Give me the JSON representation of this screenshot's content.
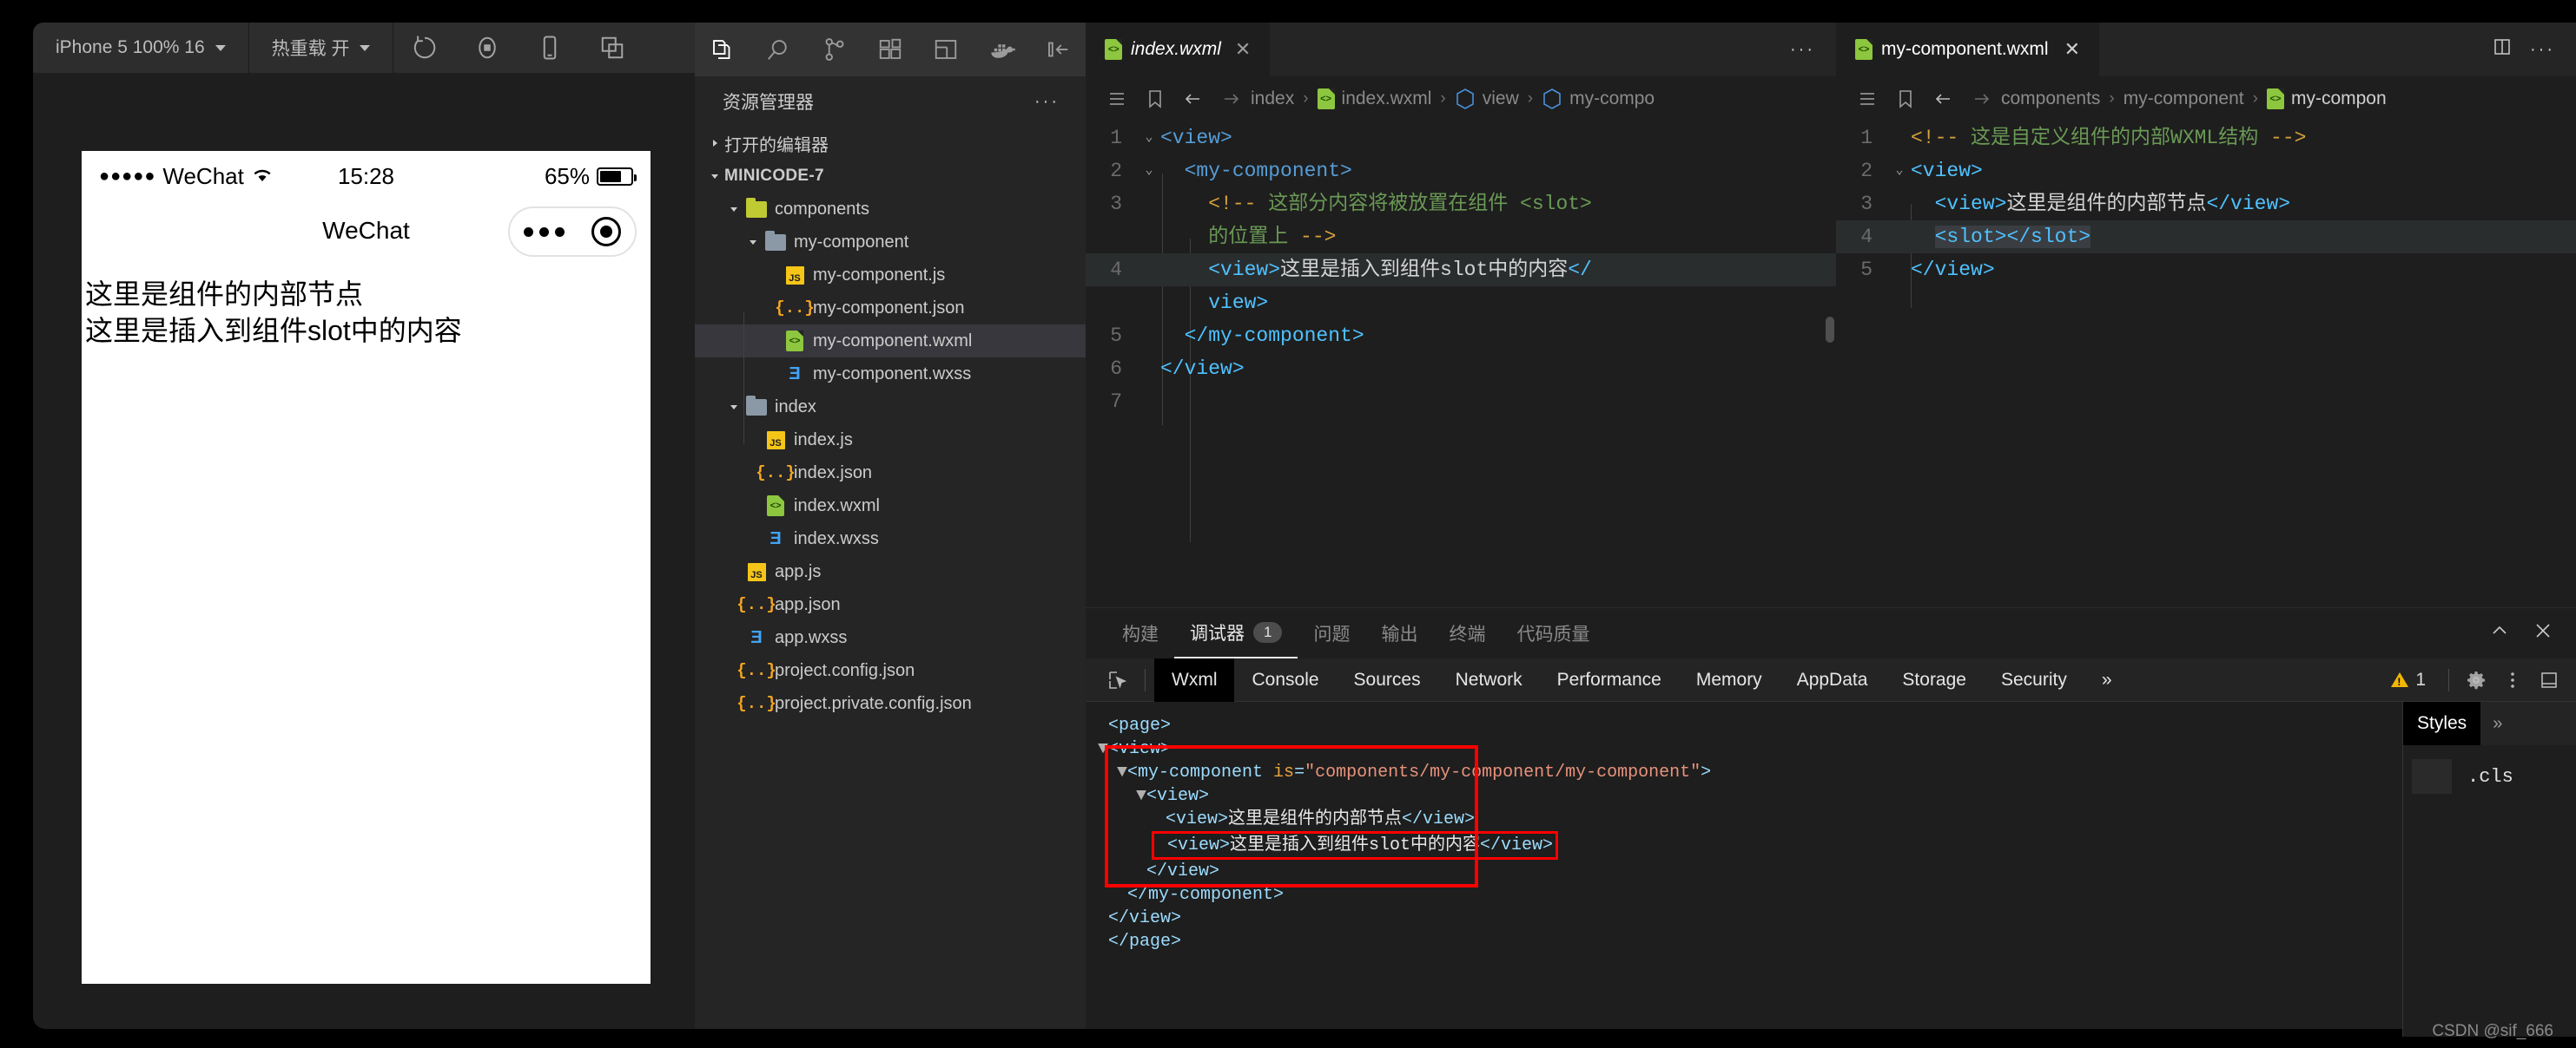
{
  "simulator": {
    "toolbar": {
      "device_label": "iPhone 5 100% 16",
      "hotreload_label": "热重载 开",
      "icons": [
        "refresh-icon",
        "record-icon",
        "phone-icon",
        "copy-icon"
      ]
    },
    "status_bar": {
      "signal_dots": "●●●●●",
      "carrier": "WeChat",
      "wifi": "wifi-icon",
      "time": "15:28",
      "battery_percent": "65%"
    },
    "nav_title": "WeChat",
    "page_lines": [
      "这里是组件的内部节点",
      "这里是插入到组件slot中的内容"
    ]
  },
  "activity_bar": {
    "icons": [
      "files-icon",
      "search-icon",
      "source-control-icon",
      "extensions-icon",
      "layout-icon",
      "docker-icon",
      "collapse-icon"
    ]
  },
  "explorer": {
    "title": "资源管理器",
    "more": "···",
    "open_editors_label": "打开的编辑器",
    "project_label": "MINICODE-7",
    "tree": [
      {
        "label": "components",
        "kind": "folder-components",
        "depth": 1,
        "expanded": true,
        "selected": false
      },
      {
        "label": "my-component",
        "kind": "folder",
        "depth": 2,
        "expanded": true,
        "selected": false
      },
      {
        "label": "my-component.js",
        "kind": "js",
        "depth": 3,
        "selected": false
      },
      {
        "label": "my-component.json",
        "kind": "json",
        "depth": 3,
        "selected": false
      },
      {
        "label": "my-component.wxml",
        "kind": "wxml",
        "depth": 3,
        "selected": true
      },
      {
        "label": "my-component.wxss",
        "kind": "wxss",
        "depth": 3,
        "selected": false
      },
      {
        "label": "index",
        "kind": "folder",
        "depth": 1,
        "expanded": true,
        "selected": false
      },
      {
        "label": "index.js",
        "kind": "js",
        "depth": 2,
        "selected": false
      },
      {
        "label": "index.json",
        "kind": "json",
        "depth": 2,
        "selected": false
      },
      {
        "label": "index.wxml",
        "kind": "wxml",
        "depth": 2,
        "selected": false
      },
      {
        "label": "index.wxss",
        "kind": "wxss",
        "depth": 2,
        "selected": false
      },
      {
        "label": "app.js",
        "kind": "js",
        "depth": 1,
        "selected": false
      },
      {
        "label": "app.json",
        "kind": "json",
        "depth": 1,
        "selected": false
      },
      {
        "label": "app.wxss",
        "kind": "wxss",
        "depth": 1,
        "selected": false
      },
      {
        "label": "project.config.json",
        "kind": "json",
        "depth": 1,
        "selected": false
      },
      {
        "label": "project.private.config.json",
        "kind": "json",
        "depth": 1,
        "selected": false
      }
    ]
  },
  "editor_center": {
    "tab_label": "index.wxml",
    "tab_close": "✕",
    "tab_more": "···",
    "breadcrumb": [
      "index",
      "index.wxml",
      "view",
      "my-compo"
    ],
    "lines": [
      {
        "num": "1",
        "fold": "chevron-down",
        "segments": [
          {
            "t": "<view>",
            "c": "tag"
          }
        ],
        "highlight": false
      },
      {
        "num": "2",
        "fold": "chevron-down",
        "segments": [
          {
            "t": "  ",
            "c": "txt"
          },
          {
            "t": "<my-component>",
            "c": "tag"
          }
        ],
        "highlight": false
      },
      {
        "num": "3",
        "fold": "",
        "segments": [
          {
            "t": "    ",
            "c": "txt"
          },
          {
            "t": "<!--",
            "c": "cmtm"
          },
          {
            "t": " 这部分内容将被放置在组件 <slot>",
            "c": "cmt"
          }
        ],
        "highlight": false
      },
      {
        "num": "",
        "fold": "",
        "segments": [
          {
            "t": "    ",
            "c": "txt"
          },
          {
            "t": "的位置上 ",
            "c": "cmt"
          },
          {
            "t": "-->",
            "c": "cmtm"
          }
        ],
        "highlight": false
      },
      {
        "num": "4",
        "fold": "",
        "segments": [
          {
            "t": "    ",
            "c": "txt"
          },
          {
            "t": "<view>",
            "c": "tag2"
          },
          {
            "t": "这里是插入到组件slot中的内容",
            "c": "txt"
          },
          {
            "t": "</",
            "c": "tag2"
          }
        ],
        "highlight": true
      },
      {
        "num": "",
        "fold": "",
        "segments": [
          {
            "t": "    ",
            "c": "txt"
          },
          {
            "t": "view>",
            "c": "tag2"
          }
        ],
        "highlight": false
      },
      {
        "num": "5",
        "fold": "",
        "segments": [
          {
            "t": "  ",
            "c": "txt"
          },
          {
            "t": "</my-component>",
            "c": "tag2"
          }
        ],
        "highlight": false
      },
      {
        "num": "6",
        "fold": "",
        "segments": [
          {
            "t": "</view>",
            "c": "tag2"
          }
        ],
        "highlight": false
      },
      {
        "num": "7",
        "fold": "",
        "segments": [],
        "highlight": false
      }
    ]
  },
  "editor_right": {
    "tab_label": "my-component.wxml",
    "tab_close": "✕",
    "split_icon": "split-editor-icon",
    "tab_more": "···",
    "breadcrumb": [
      "components",
      "my-component",
      "my-compon"
    ],
    "lines": [
      {
        "num": "1",
        "fold": "",
        "segments": [
          {
            "t": "<!--",
            "c": "cmtm"
          },
          {
            "t": " 这是自定义组件的内部WXML结构 ",
            "c": "cmt"
          },
          {
            "t": "-->",
            "c": "cmtm"
          }
        ],
        "highlight": false
      },
      {
        "num": "2",
        "fold": "chevron-down",
        "segments": [
          {
            "t": "<view>",
            "c": "tag2"
          }
        ],
        "highlight": false
      },
      {
        "num": "3",
        "fold": "",
        "segments": [
          {
            "t": "  ",
            "c": "txt"
          },
          {
            "t": "<view>",
            "c": "tag2"
          },
          {
            "t": "这里是组件的内部节点",
            "c": "txt"
          },
          {
            "t": "</view>",
            "c": "tag2"
          }
        ],
        "highlight": false
      },
      {
        "num": "4",
        "fold": "",
        "segments": [
          {
            "t": "  ",
            "c": "txt"
          },
          {
            "t": "<slot>",
            "c": "tag2"
          },
          {
            "t": "</slot>",
            "c": "tag2"
          }
        ],
        "highlight": true
      },
      {
        "num": "5",
        "fold": "",
        "segments": [
          {
            "t": "</view>",
            "c": "tag2"
          }
        ],
        "highlight": false
      }
    ]
  },
  "debugger": {
    "panel_tabs": [
      {
        "label": "构建",
        "active": false,
        "badge": ""
      },
      {
        "label": "调试器",
        "active": true,
        "badge": "1"
      },
      {
        "label": "问题",
        "active": false,
        "badge": ""
      },
      {
        "label": "输出",
        "active": false,
        "badge": ""
      },
      {
        "label": "终端",
        "active": false,
        "badge": ""
      },
      {
        "label": "代码质量",
        "active": false,
        "badge": ""
      }
    ],
    "panel_actions": [
      "chevron-up-icon",
      "close-icon"
    ],
    "devtools_tabs": [
      {
        "label": "Wxml",
        "active": true
      },
      {
        "label": "Console",
        "active": false
      },
      {
        "label": "Sources",
        "active": false
      },
      {
        "label": "Network",
        "active": false
      },
      {
        "label": "Performance",
        "active": false
      },
      {
        "label": "Memory",
        "active": false
      },
      {
        "label": "AppData",
        "active": false
      },
      {
        "label": "Storage",
        "active": false
      },
      {
        "label": "Security",
        "active": false
      },
      {
        "label": "»",
        "active": false
      }
    ],
    "warning_count": "1",
    "devtools_right_icons": [
      "gear-icon",
      "kebab-icon",
      "dock-icon"
    ],
    "inspect_icon": "inspect-cursor-icon",
    "dom_lines": [
      {
        "indent": 0,
        "arrow": "",
        "segments": [
          {
            "t": "<page>",
            "c": "tag"
          }
        ]
      },
      {
        "indent": 0,
        "arrow": "▼",
        "segments": [
          {
            "t": "<view>",
            "c": "tag"
          }
        ]
      },
      {
        "indent": 1,
        "arrow": "▼",
        "segments": [
          {
            "t": "<my-component ",
            "c": "tag"
          },
          {
            "t": "is",
            "c": "attr"
          },
          {
            "t": "=",
            "c": "tag"
          },
          {
            "t": "\"components/my-component/my-component\"",
            "c": "val"
          },
          {
            "t": ">",
            "c": "tag"
          }
        ]
      },
      {
        "indent": 2,
        "arrow": "▼",
        "segments": [
          {
            "t": "<view>",
            "c": "tag"
          }
        ]
      },
      {
        "indent": 3,
        "arrow": "",
        "segments": [
          {
            "t": "<view>",
            "c": "tag"
          },
          {
            "t": "这里是组件的内部节点",
            "c": "txt"
          },
          {
            "t": "</view>",
            "c": "tag"
          }
        ]
      },
      {
        "indent": 3,
        "arrow": "",
        "segments": [
          {
            "t": "<view>",
            "c": "tag"
          },
          {
            "t": "这里是插入到组件slot中的内容",
            "c": "txt"
          },
          {
            "t": "</view>",
            "c": "tag"
          }
        ],
        "boxed": true
      },
      {
        "indent": 2,
        "arrow": "",
        "segments": [
          {
            "t": "</view>",
            "c": "tag"
          }
        ]
      },
      {
        "indent": 1,
        "arrow": "",
        "segments": [
          {
            "t": "</my-component>",
            "c": "tag"
          }
        ]
      },
      {
        "indent": 0,
        "arrow": "",
        "segments": [
          {
            "t": "</view>",
            "c": "tag"
          }
        ]
      },
      {
        "indent": 0,
        "arrow": "",
        "segments": [
          {
            "t": "</page>",
            "c": "tag"
          }
        ]
      }
    ],
    "styles": {
      "tab_label": "Styles",
      "more": "»",
      "selector": ".cls"
    }
  },
  "watermark": "CSDN @sif_666",
  "colors": {
    "accent_blue": "#4fc1ff",
    "tag_blue": "#569cd6",
    "comment_green": "#6A9955",
    "highlight_red": "#ff0000",
    "warn_yellow": "#f2b705",
    "editor_bg": "#1e1e1e",
    "sidebar_bg": "#252526"
  }
}
